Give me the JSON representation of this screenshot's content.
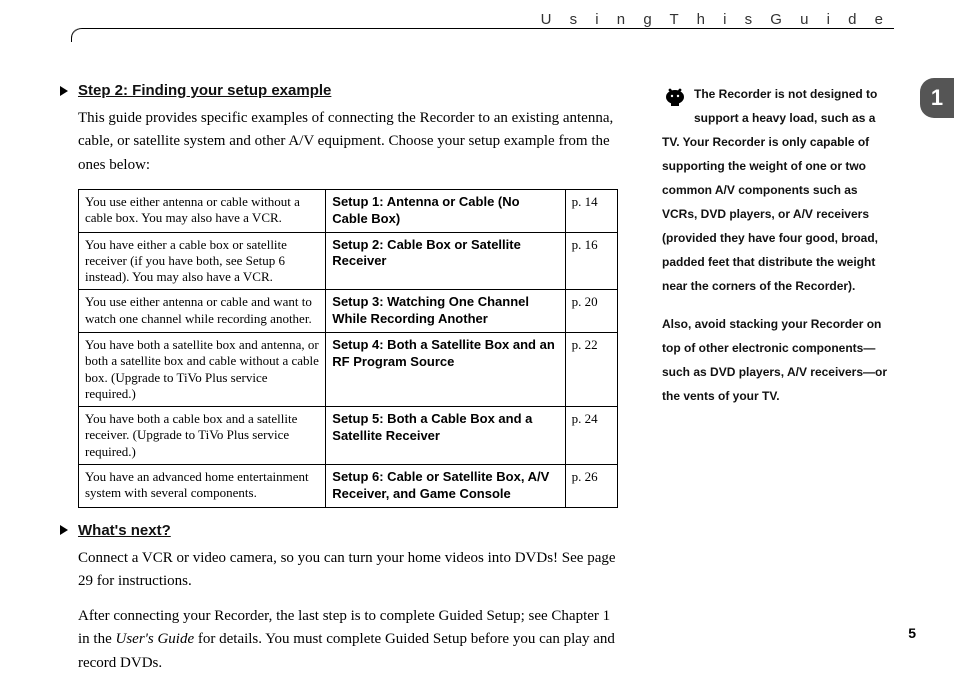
{
  "header": {
    "title": "U s i n g   T h i s   G u i d e"
  },
  "chapter": {
    "number": "1"
  },
  "section1": {
    "title": "Step 2: Finding your setup example",
    "para": "This guide provides specific examples of connecting the Recorder to an existing antenna, cable, or satellite system and other A/V equipment. Choose your setup example from the ones below:"
  },
  "table": {
    "rows": [
      {
        "desc": "You use either antenna or cable without a cable box. You may also have a VCR.",
        "name": "Setup 1: Antenna or Cable (No Cable Box)",
        "page": "p. 14"
      },
      {
        "desc": "You have either a cable box or satellite receiver (if you have both, see Setup 6 instead). You may also have a VCR.",
        "name": "Setup 2: Cable Box or Satellite Receiver",
        "page": "p. 16"
      },
      {
        "desc": "You use either antenna or cable and want to watch one channel while recording another.",
        "name": "Setup 3: Watching One Channel While Recording Another",
        "page": "p. 20"
      },
      {
        "desc": "You have both a satellite box and antenna, or both a satellite box and cable without a cable box. (Upgrade to TiVo Plus service required.)",
        "name": "Setup 4: Both a Satellite Box and an RF Program Source",
        "page": "p. 22"
      },
      {
        "desc": "You have both a cable box and a satellite receiver. (Upgrade to TiVo Plus service required.)",
        "name": "Setup 5: Both a Cable Box and a Satellite Receiver",
        "page": "p. 24"
      },
      {
        "desc": "You have an advanced home entertainment system with several components.",
        "name": "Setup 6: Cable or Satellite Box, A/V Receiver, and Game Console",
        "page": "p. 26"
      }
    ]
  },
  "section2": {
    "title": "What's next?",
    "para1": "Connect a VCR or video camera, so you can turn your home videos into DVDs! See page 29 for instructions.",
    "para2a": "After connecting your Recorder, the last step is to complete Guided Setup; see Chapter 1 in the ",
    "para2_it": "User's Guide",
    "para2b": " for details. You must complete Guided Setup before you can play and record DVDs."
  },
  "sidebar": {
    "p1": "The Recorder is not designed to support a heavy load, such as a TV. Your Recorder is only capable of supporting the weight of one or two common A/V components such as VCRs, DVD players, or A/V receivers (provided they have four good, broad, padded feet that distribute the weight near the corners of the Recorder).",
    "p2": "Also, avoid stacking your Recorder on top of other electronic components—such as DVD players, A/V receivers—or the vents of your TV."
  },
  "page_number": "5"
}
